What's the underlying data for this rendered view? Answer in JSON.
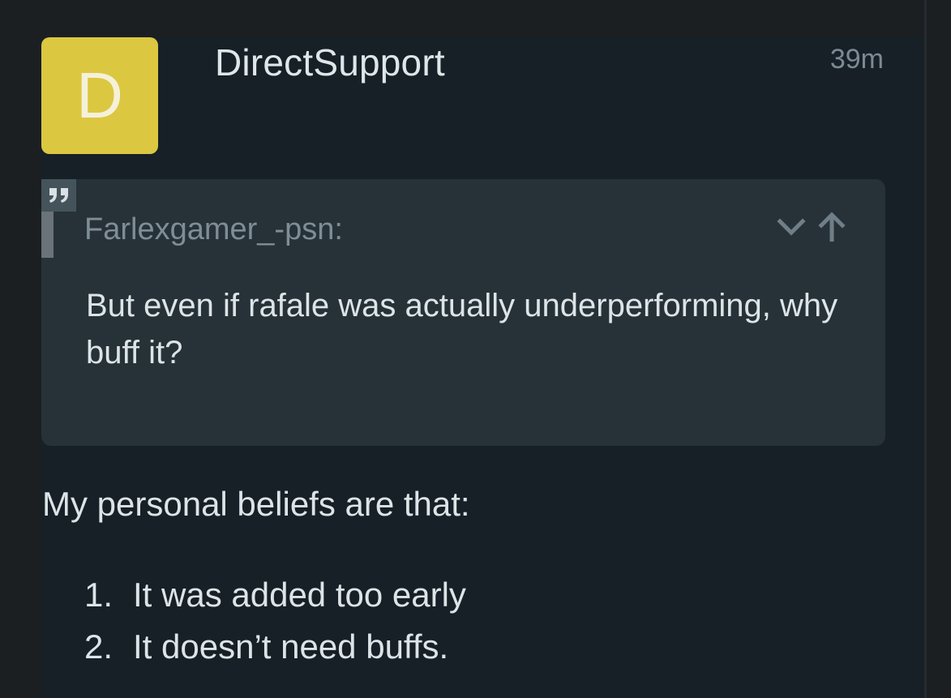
{
  "post": {
    "avatar_letter": "D",
    "avatar_color": "#dcc741",
    "username": "DirectSupport",
    "timestamp": "39m"
  },
  "quote": {
    "author": "Farlexgamer_-psn:",
    "text": "But even if rafale was actually underperforming, why buff it?",
    "icons": [
      "quote-icon",
      "chevron-down-icon",
      "arrow-up-icon"
    ]
  },
  "body": {
    "intro": "My personal beliefs are that:",
    "items": [
      {
        "number": "1.",
        "text": "It was added too early"
      },
      {
        "number": "2.",
        "text": "It doesn’t need buffs."
      }
    ]
  }
}
